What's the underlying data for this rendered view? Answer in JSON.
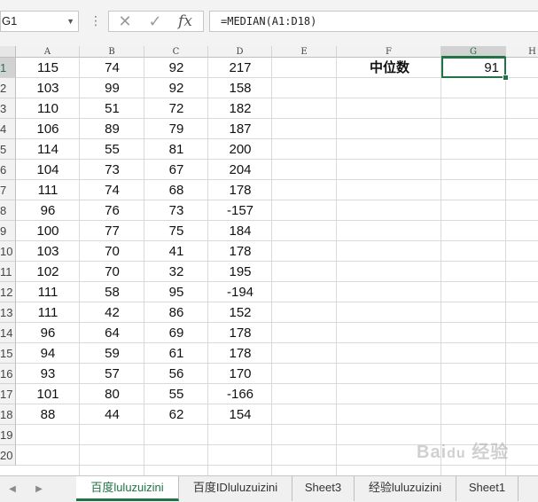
{
  "formula_bar": {
    "name_box": "G1",
    "cancel_glyph": "✕",
    "enter_glyph": "✓",
    "fx_label": "fx",
    "formula": "=MEDIAN(A1:D18)"
  },
  "columns": [
    "A",
    "B",
    "C",
    "D",
    "E",
    "F",
    "G",
    "H"
  ],
  "selected_column": "G",
  "row_numbers": [
    "1",
    "2",
    "3",
    "4",
    "5",
    "6",
    "7",
    "8",
    "9",
    "10",
    "11",
    "12",
    "13",
    "14",
    "15",
    "16",
    "17",
    "18",
    "19",
    "20"
  ],
  "selected_row": "1",
  "data_rows": [
    [
      "115",
      "74",
      "92",
      "217"
    ],
    [
      "103",
      "99",
      "92",
      "158"
    ],
    [
      "110",
      "51",
      "72",
      "182"
    ],
    [
      "106",
      "89",
      "79",
      "187"
    ],
    [
      "114",
      "55",
      "81",
      "200"
    ],
    [
      "104",
      "73",
      "67",
      "204"
    ],
    [
      "111",
      "74",
      "68",
      "178"
    ],
    [
      "96",
      "76",
      "73",
      "-157"
    ],
    [
      "100",
      "77",
      "75",
      "184"
    ],
    [
      "103",
      "70",
      "41",
      "178"
    ],
    [
      "102",
      "70",
      "32",
      "195"
    ],
    [
      "111",
      "58",
      "95",
      "-194"
    ],
    [
      "111",
      "42",
      "86",
      "152"
    ],
    [
      "96",
      "64",
      "69",
      "178"
    ],
    [
      "94",
      "59",
      "61",
      "178"
    ],
    [
      "93",
      "57",
      "56",
      "170"
    ],
    [
      "101",
      "80",
      "55",
      "-166"
    ],
    [
      "88",
      "44",
      "62",
      "154"
    ]
  ],
  "result": {
    "label": "中位数",
    "value": "91"
  },
  "sheet_tabs": [
    "百度luluzuizini",
    "百度IDluluzuizini",
    "Sheet3",
    "经验luluzuizini",
    "Sheet1"
  ],
  "active_tab": "百度luluzuizini",
  "watermark": "Baidu经验",
  "colors": {
    "accent": "#217346",
    "header_bg": "#f2f2f2",
    "selected_header_bg": "#d2d2d2"
  }
}
